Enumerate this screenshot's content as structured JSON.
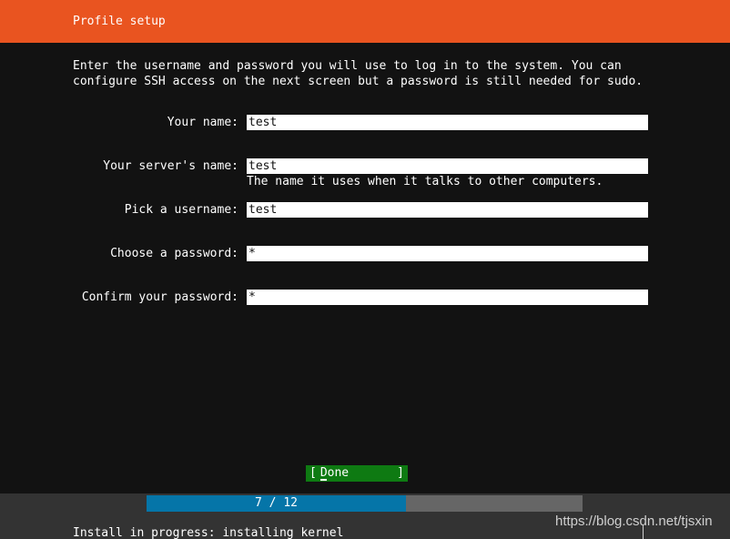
{
  "header": {
    "title": "Profile setup",
    "background_color": "#e95420"
  },
  "screen": {
    "background_color": "#121212",
    "foreground_color": "#ffffff"
  },
  "intro": {
    "text": "Enter the username and password you will use to log in to the system. You can configure SSH access on the next screen but a password is still needed for sudo."
  },
  "form": {
    "fields": [
      {
        "label": "Your name:",
        "value": "test",
        "hint": ""
      },
      {
        "label": "Your server's name:",
        "value": "test",
        "hint": "The name it uses when it talks to other computers."
      },
      {
        "label": "Pick a username:",
        "value": "test",
        "hint": ""
      },
      {
        "label": "Choose a password:",
        "value": "*",
        "hint": ""
      },
      {
        "label": "Confirm your password:",
        "value": "*",
        "hint": ""
      }
    ]
  },
  "done_button": {
    "bracket_left": "[",
    "label": "Done",
    "bracket_right": "]",
    "background_color": "#0e7a12"
  },
  "bottom": {
    "progress": {
      "text": "7 / 12",
      "current": 7,
      "total": 12,
      "fill_color": "#0575a8",
      "track_color": "#666666"
    },
    "status": "Install in progress: installing kernel",
    "bar_color": "#333333"
  },
  "watermark": {
    "text": "https://blog.csdn.net/tjsxin"
  }
}
